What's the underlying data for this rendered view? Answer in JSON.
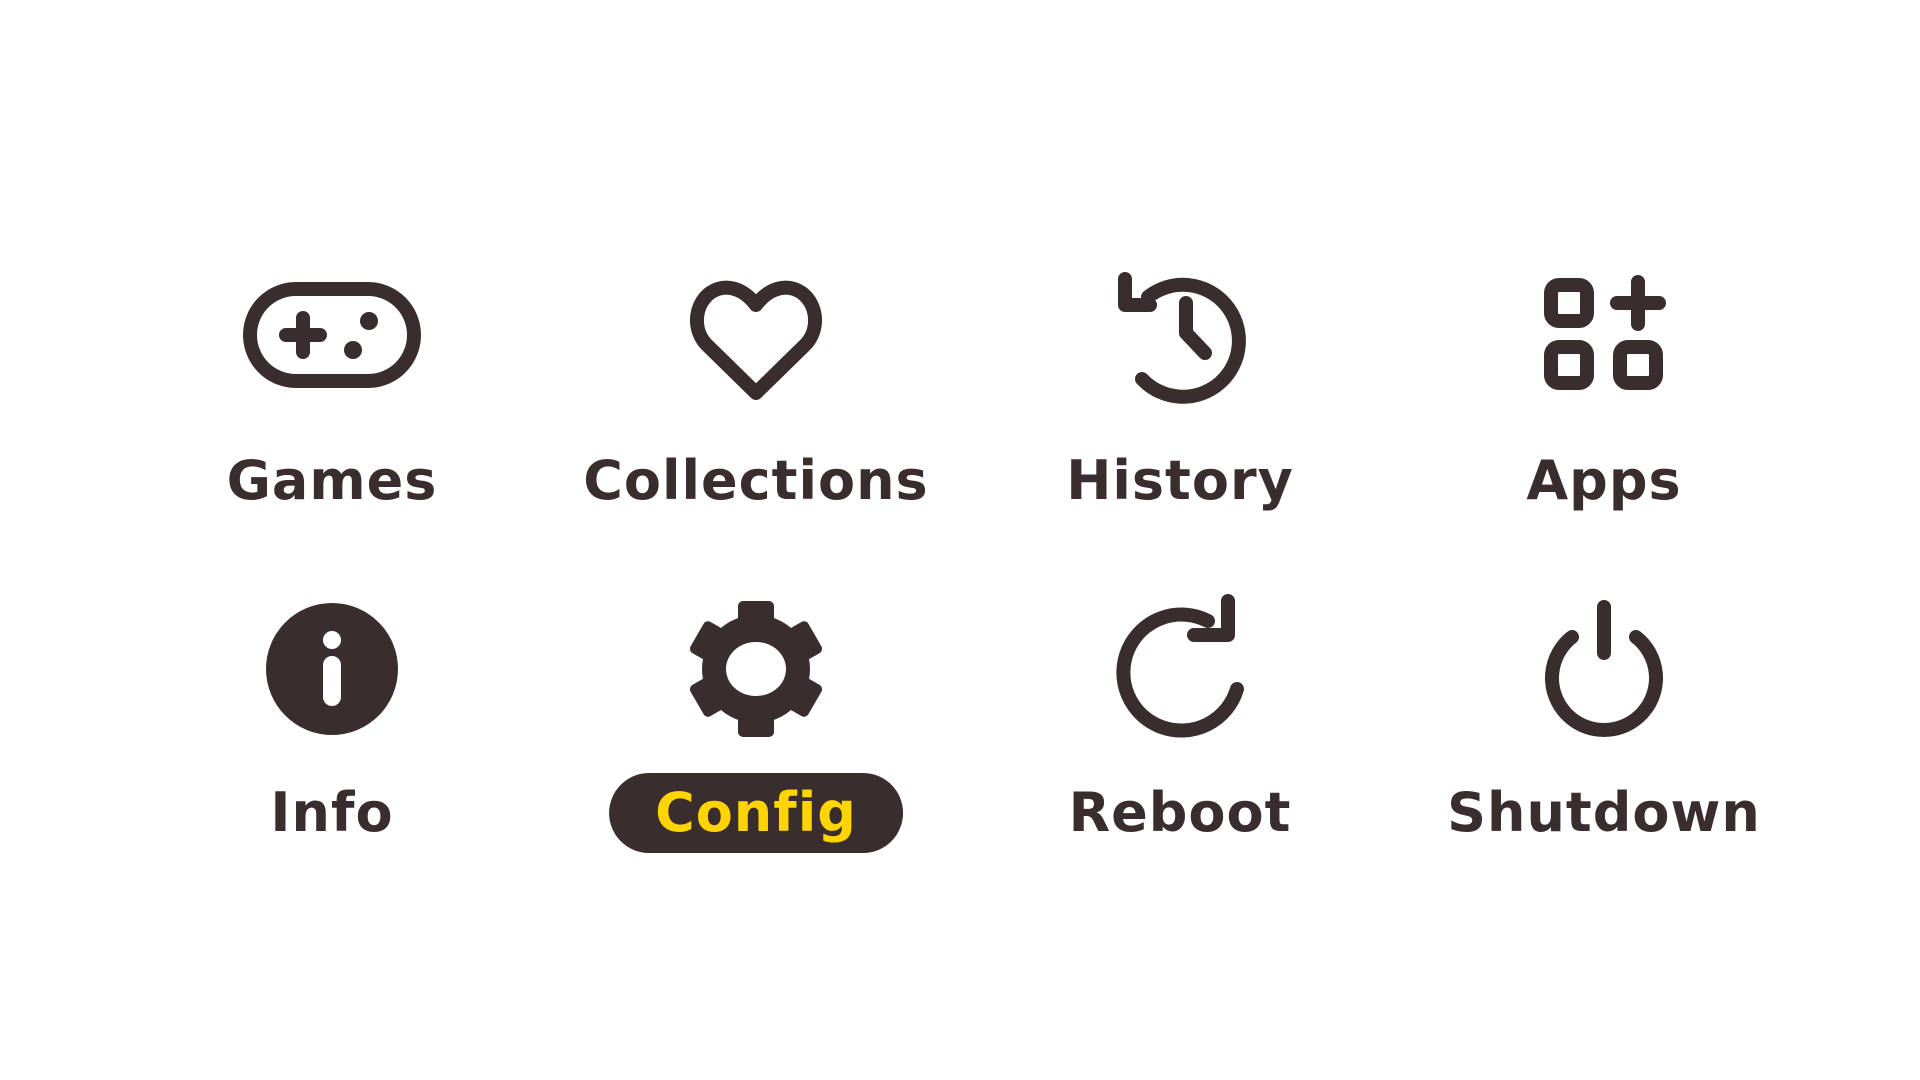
{
  "theme": {
    "foreground": "#3a2d2d",
    "background": "#ffffff",
    "selected_label_color": "#ffd400"
  },
  "menu": {
    "selected": "Config",
    "items": [
      {
        "id": "games",
        "label": "Games",
        "icon": "gamepad-icon"
      },
      {
        "id": "collections",
        "label": "Collections",
        "icon": "heart-icon"
      },
      {
        "id": "history",
        "label": "History",
        "icon": "history-clock-icon"
      },
      {
        "id": "apps",
        "label": "Apps",
        "icon": "apps-grid-icon"
      },
      {
        "id": "info",
        "label": "Info",
        "icon": "info-icon"
      },
      {
        "id": "config",
        "label": "Config",
        "icon": "gear-icon"
      },
      {
        "id": "reboot",
        "label": "Reboot",
        "icon": "reboot-icon"
      },
      {
        "id": "shutdown",
        "label": "Shutdown",
        "icon": "power-icon"
      }
    ]
  }
}
